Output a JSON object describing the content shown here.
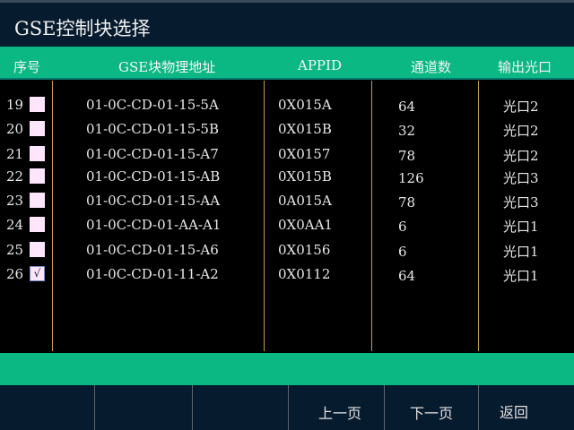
{
  "title": "GSE控制块选择",
  "columns": [
    "序号",
    "GSE块物理地址",
    "APPID",
    "通道数",
    "输出光口"
  ],
  "rows": [
    {
      "no": "19",
      "checked": false,
      "mac": "01-0C-CD-01-15-5A",
      "appid": "0X015A",
      "channels": "64",
      "port": "光口2"
    },
    {
      "no": "20",
      "checked": false,
      "mac": "01-0C-CD-01-15-5B",
      "appid": "0X015B",
      "channels": "32",
      "port": "光口2"
    },
    {
      "no": "21",
      "checked": false,
      "mac": "01-0C-CD-01-15-A7",
      "appid": "0X0157",
      "channels": "78",
      "port": "光口2"
    },
    {
      "no": "22",
      "checked": false,
      "mac": "01-0C-CD-01-15-AB",
      "appid": "0X015B",
      "channels": "126",
      "port": "光口3"
    },
    {
      "no": "23",
      "checked": false,
      "mac": "01-0C-CD-01-15-AA",
      "appid": "0A015A",
      "channels": "78",
      "port": "光口3"
    },
    {
      "no": "24",
      "checked": false,
      "mac": "01-0C-CD-01-AA-A1",
      "appid": "0X0AA1",
      "channels": "6",
      "port": "光口1"
    },
    {
      "no": "25",
      "checked": false,
      "mac": "01-0C-CD-01-15-A6",
      "appid": "0X0156",
      "channels": "6",
      "port": "光口1"
    },
    {
      "no": "26",
      "checked": true,
      "mac": "01-0C-CD-01-11-A2",
      "appid": "0X0112",
      "channels": "64",
      "port": "光口1"
    }
  ],
  "check_mark": "√",
  "footer": {
    "prev": "上一页",
    "next": "下一页",
    "back": "返回"
  }
}
